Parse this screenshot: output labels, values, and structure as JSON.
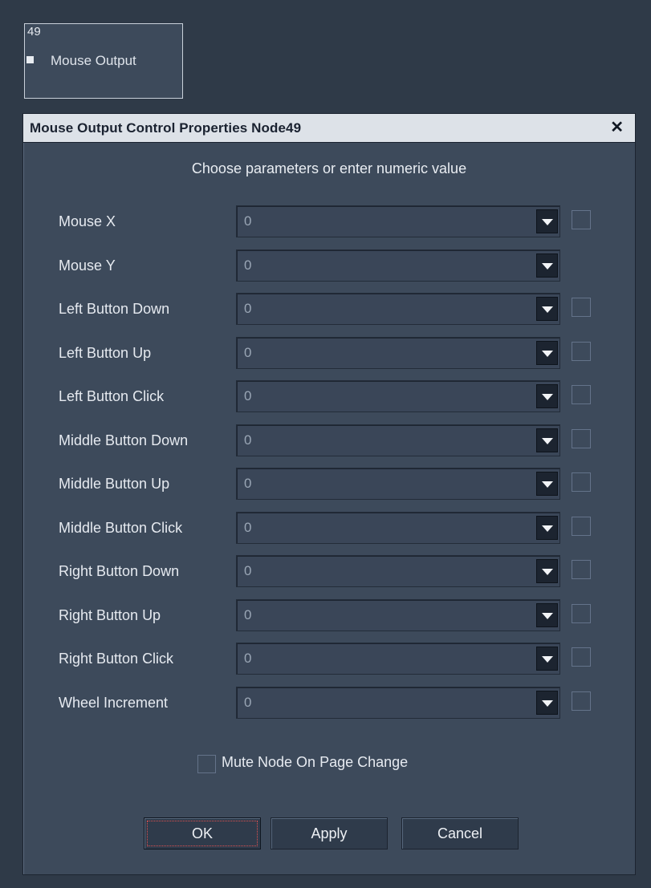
{
  "node": {
    "id": "49",
    "label": "Mouse Output"
  },
  "dialog": {
    "title": "Mouse Output Control Properties Node49",
    "close_glyph": "✕",
    "subtitle": "Choose parameters or enter numeric value",
    "rows": [
      {
        "label": "Mouse X",
        "value": "0",
        "has_checkbox": true
      },
      {
        "label": "Mouse Y",
        "value": "0",
        "has_checkbox": false
      },
      {
        "label": "Left Button Down",
        "value": "0",
        "has_checkbox": true
      },
      {
        "label": "Left Button Up",
        "value": "0",
        "has_checkbox": true
      },
      {
        "label": "Left Button Click",
        "value": "0",
        "has_checkbox": true
      },
      {
        "label": "Middle Button Down",
        "value": "0",
        "has_checkbox": true
      },
      {
        "label": "Middle Button Up",
        "value": "0",
        "has_checkbox": true
      },
      {
        "label": "Middle Button Click",
        "value": "0",
        "has_checkbox": true
      },
      {
        "label": "Right Button Down",
        "value": "0",
        "has_checkbox": true
      },
      {
        "label": "Right Button Up",
        "value": "0",
        "has_checkbox": true
      },
      {
        "label": "Right Button Click",
        "value": "0",
        "has_checkbox": true
      },
      {
        "label": "Wheel Increment",
        "value": "0",
        "has_checkbox": true
      }
    ],
    "mute_label": "Mute Node On Page Change",
    "mute_checked": false,
    "buttons": {
      "ok": "OK",
      "apply": "Apply",
      "cancel": "Cancel"
    }
  },
  "colors": {
    "background": "#2f3a48",
    "panel": "#3d4a5b",
    "titlebar": "#dde2e8",
    "combo_button": "#1c2430"
  }
}
